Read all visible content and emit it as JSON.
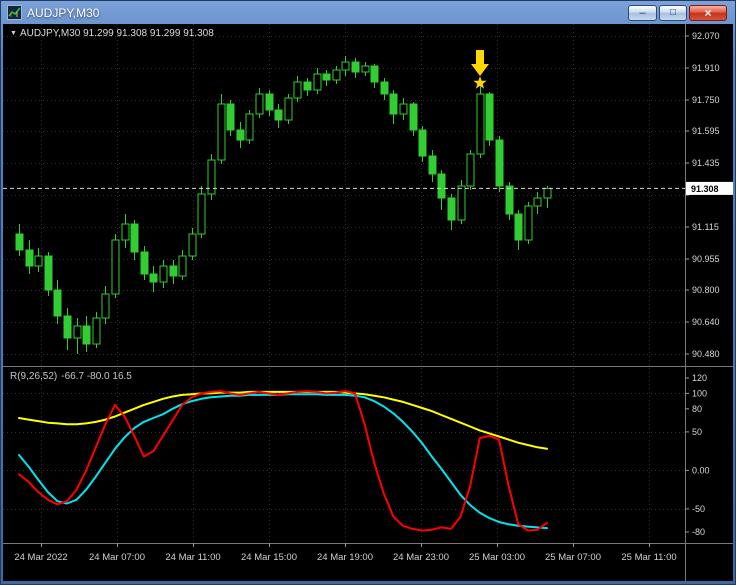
{
  "window": {
    "title": "AUDJPY,M30",
    "controls": {
      "minimize_glyph": "–",
      "maximize_glyph": "□",
      "close_glyph": "×"
    }
  },
  "chart_header": {
    "dropdown_glyph": "▼",
    "text": "AUDJPY,M30 91.299 91.308 91.299 91.308"
  },
  "chart_data": {
    "type": "candlestick",
    "symbol": "AUDJPY",
    "timeframe": "M30",
    "title": "AUDJPY,M30",
    "quote": {
      "open": "91.299",
      "high": "91.308",
      "low": "91.299",
      "close": "91.308"
    },
    "current_bid": 91.308,
    "price_axis": {
      "range": [
        90.45,
        92.11
      ],
      "ticks": [
        92.07,
        91.91,
        91.75,
        91.595,
        91.435,
        91.275,
        91.115,
        90.955,
        90.8,
        90.64,
        90.48
      ],
      "labels": [
        "92.070",
        "91.910",
        "91.750",
        "91.595",
        "91.435",
        "",
        "91.115",
        "90.955",
        "90.800",
        "90.640",
        "90.480"
      ],
      "current_label": "91.308"
    },
    "time_axis": {
      "labels": [
        "24 Mar 2022",
        "24 Mar 07:00",
        "24 Mar 11:00",
        "24 Mar 15:00",
        "24 Mar 19:00",
        "24 Mar 23:00",
        "25 Mar 03:00",
        "25 Mar 07:00",
        "25 Mar 11:00"
      ]
    },
    "candles": [
      [
        91.08,
        91.13,
        90.97,
        91.0
      ],
      [
        91.0,
        91.05,
        90.88,
        90.92
      ],
      [
        90.92,
        91.01,
        90.89,
        90.97
      ],
      [
        90.97,
        90.99,
        90.77,
        90.8
      ],
      [
        90.8,
        90.85,
        90.63,
        90.67
      ],
      [
        90.67,
        90.71,
        90.5,
        90.56
      ],
      [
        90.56,
        90.66,
        90.48,
        90.62
      ],
      [
        90.62,
        90.67,
        90.49,
        90.53
      ],
      [
        90.53,
        90.69,
        90.51,
        90.66
      ],
      [
        90.66,
        90.82,
        90.63,
        90.78
      ],
      [
        90.78,
        91.08,
        90.76,
        91.05
      ],
      [
        91.05,
        91.18,
        91.01,
        91.13
      ],
      [
        91.13,
        91.15,
        90.95,
        90.99
      ],
      [
        90.99,
        91.02,
        90.85,
        90.88
      ],
      [
        90.88,
        90.92,
        90.79,
        90.84
      ],
      [
        90.84,
        90.95,
        90.81,
        90.92
      ],
      [
        90.92,
        90.95,
        90.83,
        90.87
      ],
      [
        90.87,
        91.0,
        90.85,
        90.97
      ],
      [
        90.97,
        91.11,
        90.95,
        91.08
      ],
      [
        91.08,
        91.32,
        91.06,
        91.28
      ],
      [
        91.28,
        91.48,
        91.25,
        91.45
      ],
      [
        91.45,
        91.78,
        91.43,
        91.73
      ],
      [
        91.73,
        91.75,
        91.57,
        91.6
      ],
      [
        91.6,
        91.64,
        91.51,
        91.55
      ],
      [
        91.55,
        91.7,
        91.53,
        91.68
      ],
      [
        91.68,
        91.81,
        91.66,
        91.78
      ],
      [
        91.78,
        91.8,
        91.67,
        91.7
      ],
      [
        91.7,
        91.73,
        91.61,
        91.65
      ],
      [
        91.65,
        91.78,
        91.63,
        91.76
      ],
      [
        91.76,
        91.87,
        91.74,
        91.84
      ],
      [
        91.84,
        91.86,
        91.77,
        91.8
      ],
      [
        91.8,
        91.91,
        91.78,
        91.88
      ],
      [
        91.88,
        91.9,
        91.82,
        91.85
      ],
      [
        91.85,
        91.92,
        91.83,
        91.9
      ],
      [
        91.9,
        91.97,
        91.87,
        91.94
      ],
      [
        91.94,
        91.96,
        91.86,
        91.89
      ],
      [
        91.89,
        91.94,
        91.87,
        91.92
      ],
      [
        91.92,
        91.93,
        91.81,
        91.84
      ],
      [
        91.84,
        91.86,
        91.75,
        91.78
      ],
      [
        91.78,
        91.8,
        91.63,
        91.68
      ],
      [
        91.68,
        91.76,
        91.65,
        91.73
      ],
      [
        91.73,
        91.74,
        91.57,
        91.6
      ],
      [
        91.6,
        91.62,
        91.44,
        91.47
      ],
      [
        91.47,
        91.5,
        91.34,
        91.38
      ],
      [
        91.38,
        91.4,
        91.2,
        91.26
      ],
      [
        91.26,
        91.28,
        91.1,
        91.15
      ],
      [
        91.15,
        91.35,
        91.13,
        91.32
      ],
      [
        91.32,
        91.5,
        91.3,
        91.48
      ],
      [
        91.48,
        91.82,
        91.46,
        91.78
      ],
      [
        91.78,
        91.79,
        91.52,
        91.55
      ],
      [
        91.55,
        91.57,
        91.29,
        91.32
      ],
      [
        91.32,
        91.34,
        91.15,
        91.18
      ],
      [
        91.18,
        91.2,
        91.0,
        91.05
      ],
      [
        91.05,
        91.24,
        91.03,
        91.22
      ],
      [
        91.22,
        91.29,
        91.18,
        91.26
      ],
      [
        91.26,
        91.32,
        91.21,
        91.308
      ]
    ],
    "markers": [
      {
        "type": "arrow-down",
        "bar": 48,
        "color": "#ffd700"
      },
      {
        "type": "star",
        "bar": 48,
        "color": "#ffd700"
      }
    ],
    "colors": {
      "candle": "#32cd32",
      "bull_fill": "#000000",
      "grid": "#333333",
      "frame": "#787878",
      "bid_line": "#d9d9d9",
      "axis_text": "#d6d6d6",
      "tick": "#9a9a9a"
    },
    "indicator": {
      "label": "R(9,26,52)",
      "values_label": "-66.7 -80.0 16.5",
      "axis": {
        "ticks": [
          120,
          100,
          80,
          50,
          0,
          -50,
          -80
        ],
        "labels": [
          "120",
          "100",
          "80",
          "50",
          "0.00",
          "-50",
          "-80"
        ],
        "grid_ticks": [
          100,
          50,
          0,
          -50
        ]
      },
      "series": [
        {
          "name": "yellow",
          "color": "#ffff00",
          "width": 2,
          "values": [
            68,
            66,
            64,
            62,
            61,
            60,
            60,
            61,
            63,
            66,
            70,
            75,
            80,
            85,
            89,
            93,
            96,
            98,
            99,
            100,
            100,
            101,
            101,
            101,
            102,
            102,
            102,
            102,
            102,
            102,
            102,
            102,
            102,
            102,
            101,
            100,
            99,
            97,
            95,
            92,
            89,
            85,
            81,
            77,
            72,
            67,
            62,
            57,
            52,
            48,
            44,
            40,
            36,
            33,
            30,
            28
          ]
        },
        {
          "name": "aqua",
          "color": "#00e5ee",
          "width": 2,
          "values": [
            20,
            5,
            -12,
            -28,
            -40,
            -43,
            -38,
            -25,
            -8,
            10,
            28,
            43,
            55,
            63,
            68,
            73,
            80,
            86,
            90,
            93,
            95,
            96,
            97,
            97,
            98,
            98,
            98,
            98,
            99,
            99,
            99,
            99,
            98,
            98,
            98,
            97,
            95,
            90,
            83,
            74,
            63,
            50,
            35,
            18,
            2,
            -15,
            -32,
            -45,
            -55,
            -62,
            -67,
            -70,
            -72,
            -73,
            -74,
            -75
          ]
        },
        {
          "name": "red",
          "color": "#ff0000",
          "width": 2,
          "values": [
            -5,
            -15,
            -28,
            -38,
            -44,
            -40,
            -25,
            0,
            30,
            60,
            85,
            70,
            45,
            18,
            25,
            45,
            65,
            85,
            95,
            100,
            102,
            103,
            100,
            98,
            100,
            102,
            100,
            98,
            100,
            102,
            103,
            102,
            100,
            101,
            103,
            100,
            60,
            10,
            -30,
            -60,
            -72,
            -76,
            -78,
            -77,
            -74,
            -76,
            -60,
            -20,
            42,
            45,
            40,
            -20,
            -70,
            -78,
            -77,
            -68
          ]
        }
      ]
    }
  }
}
